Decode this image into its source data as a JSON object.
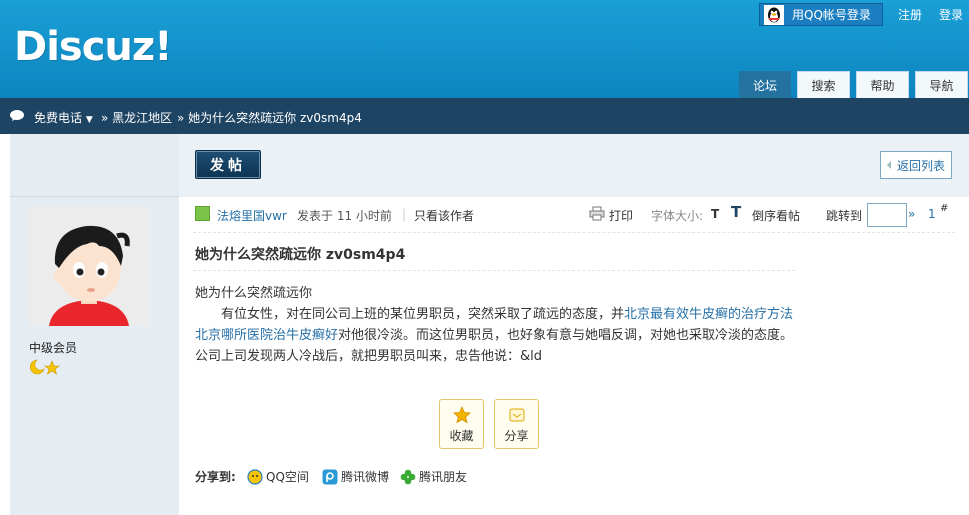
{
  "header": {
    "logo": "Discuz!",
    "qq_login": "用QQ帐号登录",
    "register": "注册",
    "login": "登录",
    "tabs": [
      "论坛",
      "搜索",
      "帮助",
      "导航"
    ]
  },
  "breadcrumb": {
    "phone": "免费电话",
    "region": "» 黑龙江地区",
    "thread": "» 她为什么突然疏远你 zv0sm4p4"
  },
  "toolbar": {
    "post_label": "发帖",
    "back_label": "返回列表"
  },
  "author": {
    "name": "法熔里国vwr",
    "rank": "中级会员"
  },
  "post_meta": {
    "posted": "发表于 11 小时前",
    "only_author": "只看该作者",
    "print": "打印",
    "font_size": "字体大小:",
    "font_t": "T",
    "reverse": "倒序看帖",
    "jump": "跳转到",
    "jump_arrow": "»",
    "floor": "1",
    "floor_mark": "#"
  },
  "post": {
    "title": "她为什么突然疏远你 zv0sm4p4",
    "line1": "她为什么突然疏远你",
    "p2_pre": "有位女性，对在同公司上班的某位男职员，突然采取了疏远的态度，并",
    "p2_link": "北京最有效牛皮癣的治疗方法北京哪所医院治牛皮癣好",
    "p2_post": "对他很冷淡。而这位男职员，也好象有意与她唱反调，对她也采取冷淡的态度。公司上司发现两人冷战后，就把男职员叫来，忠告他说：&ld"
  },
  "actions": {
    "favorite": "收藏",
    "share": "分享"
  },
  "share_bar": {
    "label": "分享到:",
    "qzone": "QQ空间",
    "weibo": "腾讯微博",
    "friends": "腾讯朋友"
  },
  "colors": {
    "header_blue": "#1aa0d6",
    "breadcrumb_bg": "#1e4463",
    "link_blue": "#2670a8",
    "sidebar_bg": "#e5edf2"
  }
}
